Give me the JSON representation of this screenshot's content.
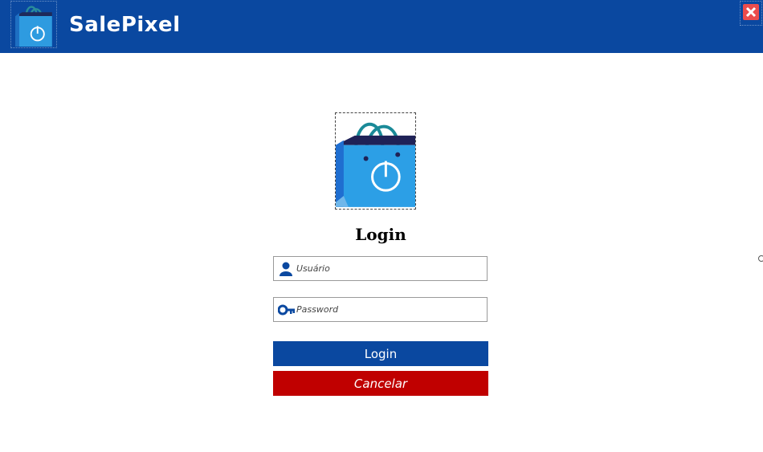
{
  "window": {
    "title": "SalePixel",
    "logo_icon": "shopping-bag-power-icon",
    "close_icon": "close-icon"
  },
  "login": {
    "logo_icon": "shopping-bag-power-icon",
    "heading": "Login",
    "username": {
      "placeholder": "Usuário",
      "value": "",
      "icon": "user-icon"
    },
    "password": {
      "placeholder": "Password",
      "value": "",
      "icon": "key-icon"
    },
    "login_button": "Login",
    "cancel_button": "Cancelar"
  },
  "colors": {
    "header": "#0a48a0",
    "login_button": "#0a48a0",
    "cancel_button": "#c00000",
    "close_button": "#ec4c4c"
  }
}
